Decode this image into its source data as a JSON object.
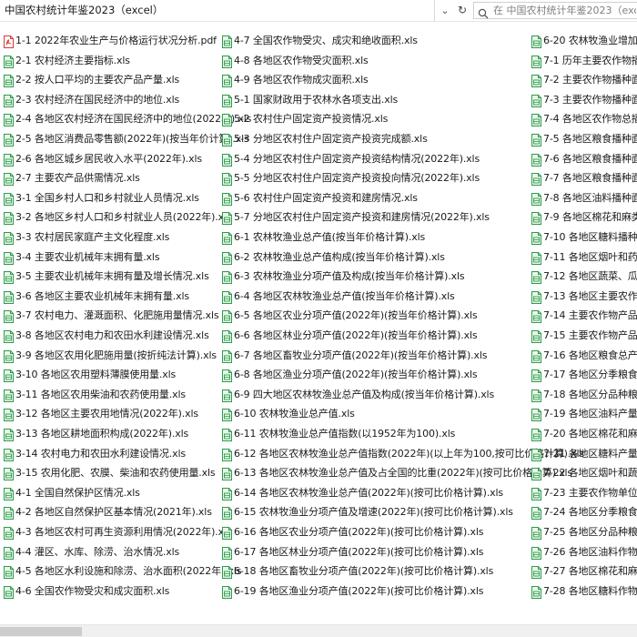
{
  "address_bar": {
    "path": "中国农村统计年鉴2023（excel）"
  },
  "search": {
    "placeholder": "在 中国农村统计年鉴2023（excel）中搜索"
  },
  "icons": {
    "pdf_color": "#d93a3a",
    "xls_color": "#2e9c4a",
    "xls_fill": "#eaf6ec"
  },
  "columns": [
    [
      {
        "name": "1-1 2022年农业生产与价格运行状况分析.pdf",
        "type": "pdf"
      },
      {
        "name": "2-1 农村经济主要指标.xls",
        "type": "xls"
      },
      {
        "name": "2-2 按人口平均的主要农产品产量.xls",
        "type": "xls"
      },
      {
        "name": "2-3 农村经济在国民经济中的地位.xls",
        "type": "xls"
      },
      {
        "name": "2-4 各地区农村经济在国民经济中的地位(2022年).xls",
        "type": "xls"
      },
      {
        "name": "2-5 各地区消费品零售额(2022年)(按当年价计算).xls",
        "type": "xls"
      },
      {
        "name": "2-6 各地区城乡居民收入水平(2022年).xls",
        "type": "xls"
      },
      {
        "name": "2-7 主要农产品供需情况.xls",
        "type": "xls"
      },
      {
        "name": "3-1 全国乡村人口和乡村就业人员情况.xls",
        "type": "xls"
      },
      {
        "name": "3-2 各地区乡村人口和乡村就业人员(2022年).xls",
        "type": "xls"
      },
      {
        "name": "3-3 农村居民家庭产主文化程度.xls",
        "type": "xls"
      },
      {
        "name": "3-4 主要农业机械年末拥有量.xls",
        "type": "xls"
      },
      {
        "name": "3-5 主要农业机械年末拥有量及增长情况.xls",
        "type": "xls"
      },
      {
        "name": "3-6 各地区主要农业机械年末拥有量.xls",
        "type": "xls"
      },
      {
        "name": "3-7 农村电力、灌溉面积、化肥施用量情况.xls",
        "type": "xls"
      },
      {
        "name": "3-8 各地区农村电力和农田水利建设情况.xls",
        "type": "xls"
      },
      {
        "name": "3-9 各地区农用化肥施用量(按折纯法计算).xls",
        "type": "xls"
      },
      {
        "name": "3-10 各地区农用塑料薄膜使用量.xls",
        "type": "xls"
      },
      {
        "name": "3-11 各地区农用柴油和农药使用量.xls",
        "type": "xls"
      },
      {
        "name": "3-12 各地区主要农用地情况(2022年).xls",
        "type": "xls"
      },
      {
        "name": "3-13 各地区耕地面积构成(2022年).xls",
        "type": "xls"
      },
      {
        "name": "3-14 农村电力和农田水利建设情况.xls",
        "type": "xls"
      },
      {
        "name": "3-15 农用化肥、农膜、柴油和农药使用量.xls",
        "type": "xls"
      },
      {
        "name": "4-1 全国自然保护区情况.xls",
        "type": "xls"
      },
      {
        "name": "4-2 各地区自然保护区基本情况(2021年).xls",
        "type": "xls"
      },
      {
        "name": "4-3 各地区农村可再生资源利用情况(2022年).xls",
        "type": "xls"
      },
      {
        "name": "4-4 灌区、水库、除涝、治水情况.xls",
        "type": "xls"
      },
      {
        "name": "4-5 各地区水利设施和除涝、治水面积(2022年).xls",
        "type": "xls"
      },
      {
        "name": "4-6 全国农作物受灾和成灾面积.xls",
        "type": "xls"
      }
    ],
    [
      {
        "name": "4-7 全国农作物受灾、成灾和绝收面积.xls",
        "type": "xls"
      },
      {
        "name": "4-8 各地区农作物受灾面积.xls",
        "type": "xls"
      },
      {
        "name": "4-9 各地区农作物成灾面积.xls",
        "type": "xls"
      },
      {
        "name": "5-1 国家财政用于农林水各项支出.xls",
        "type": "xls"
      },
      {
        "name": "5-2 农村住户固定资产投资情况.xls",
        "type": "xls"
      },
      {
        "name": "5-3 分地区农村住户固定资产投资完成额.xls",
        "type": "xls"
      },
      {
        "name": "5-4 分地区农村住户固定资产投资结构情况(2022年).xls",
        "type": "xls"
      },
      {
        "name": "5-5 分地区农村住户固定资产投资投向情况(2022年).xls",
        "type": "xls"
      },
      {
        "name": "5-6 农村住户固定资产投资和建房情况.xls",
        "type": "xls"
      },
      {
        "name": "5-7 分地区农村住户固定资产投资和建房情况(2022年).xls",
        "type": "xls"
      },
      {
        "name": "6-1 农林牧渔业总产值(按当年价格计算).xls",
        "type": "xls"
      },
      {
        "name": "6-2 农林牧渔业总产值构成(按当年价格计算).xls",
        "type": "xls"
      },
      {
        "name": "6-3 农林牧渔业分项产值及构成(按当年价格计算).xls",
        "type": "xls"
      },
      {
        "name": "6-4 各地区农林牧渔业总产值(按当年价格计算).xls",
        "type": "xls"
      },
      {
        "name": "6-5 各地区农业分项产值(2022年)(按当年价格计算).xls",
        "type": "xls"
      },
      {
        "name": "6-6 各地区林业分项产值(2022年)(按当年价格计算).xls",
        "type": "xls"
      },
      {
        "name": "6-7 各地区畜牧业分项产值(2022年)(按当年价格计算).xls",
        "type": "xls"
      },
      {
        "name": "6-8 各地区渔业分项产值(2022年)(按当年价格计算).xls",
        "type": "xls"
      },
      {
        "name": "6-9 四大地区农林牧渔业总产值及构成(按当年价格计算).xls",
        "type": "xls"
      },
      {
        "name": "6-10 农林牧渔业总产值.xls",
        "type": "xls"
      },
      {
        "name": "6-11 农林牧渔业总产值指数(以1952年为100).xls",
        "type": "xls"
      },
      {
        "name": "6-12 各地区农林牧渔业总产值指数(2022年)(以上年为100,按可比价格计算).xls",
        "type": "xls"
      },
      {
        "name": "6-13 各地区农林牧渔业总产值及占全国的比重(2022年)(按可比价格计算).xls",
        "type": "xls"
      },
      {
        "name": "6-14 各地区农林牧渔业总产值(2022年)(按可比价格计算).xls",
        "type": "xls"
      },
      {
        "name": "6-15 农林牧渔业分项产值及增速(2022年)(按可比价格计算).xls",
        "type": "xls"
      },
      {
        "name": "6-16 各地区农业分项产值(2022年)(按可比价格计算).xls",
        "type": "xls"
      },
      {
        "name": "6-17 各地区林业分项产值(2022年)(按可比价格计算).xls",
        "type": "xls"
      },
      {
        "name": "6-18 各地区畜牧业分项产值(2022年)(按可比价格计算).xls",
        "type": "xls"
      },
      {
        "name": "6-19 各地区渔业分项产值(2022年)(按可比价格计算).xls",
        "type": "xls"
      }
    ],
    [
      {
        "name": "6-20 农林牧渔业增加值和",
        "type": "xls"
      },
      {
        "name": "7-1 历年主要农作物播种面",
        "type": "xls"
      },
      {
        "name": "7-2 主要农作物播种面积",
        "type": "xls"
      },
      {
        "name": "7-3 主要农作物播种面积构",
        "type": "xls"
      },
      {
        "name": "7-4 各地区农作物总播种面",
        "type": "xls"
      },
      {
        "name": "7-5 各地区粮食播种面积(",
        "type": "xls"
      },
      {
        "name": "7-6 各地区粮食播种面积(按",
        "type": "xls"
      },
      {
        "name": "7-7 各地区粮食播种面积(按",
        "type": "xls"
      },
      {
        "name": "7-8 各地区油料播种面积(",
        "type": "xls"
      },
      {
        "name": "7-9 各地区棉花和麻类播种",
        "type": "xls"
      },
      {
        "name": "7-10 各地区糖料播种面积(",
        "type": "xls"
      },
      {
        "name": "7-11 各地区烟叶和药材播种",
        "type": "xls"
      },
      {
        "name": "7-12 各地区蔬菜、瓜果类和",
        "type": "xls"
      },
      {
        "name": "7-13 各地区主要农作物播种",
        "type": "xls"
      },
      {
        "name": "7-14 主要农作物产品产量(",
        "type": "xls"
      },
      {
        "name": "7-15 主要农作物产品产量(",
        "type": "xls"
      },
      {
        "name": "7-16 各地区粮食总产量.xls",
        "type": "xls"
      },
      {
        "name": "7-17 各地区分季粮食作物产",
        "type": "xls"
      },
      {
        "name": "7-18 各地区分品种粮食作物",
        "type": "xls"
      },
      {
        "name": "7-19 各地区油料产量.xls",
        "type": "xls"
      },
      {
        "name": "7-20 各地区棉花和麻类产量",
        "type": "xls"
      },
      {
        "name": "7-21 各地区糖料产量.xls",
        "type": "xls"
      },
      {
        "name": "7-22 各地区烟叶和蔬菜产量",
        "type": "xls"
      },
      {
        "name": "7-23 主要农作物单位面积产",
        "type": "xls"
      },
      {
        "name": "7-24 各地区分季粮食作物单",
        "type": "xls"
      },
      {
        "name": "7-25 各地区分品种粮食作物",
        "type": "xls"
      },
      {
        "name": "7-26 各地区油料作物单位面",
        "type": "xls"
      },
      {
        "name": "7-27 各地区棉花和麻类作物",
        "type": "xls"
      },
      {
        "name": "7-28 各地区糖料作物单位面",
        "type": "xls"
      }
    ]
  ]
}
